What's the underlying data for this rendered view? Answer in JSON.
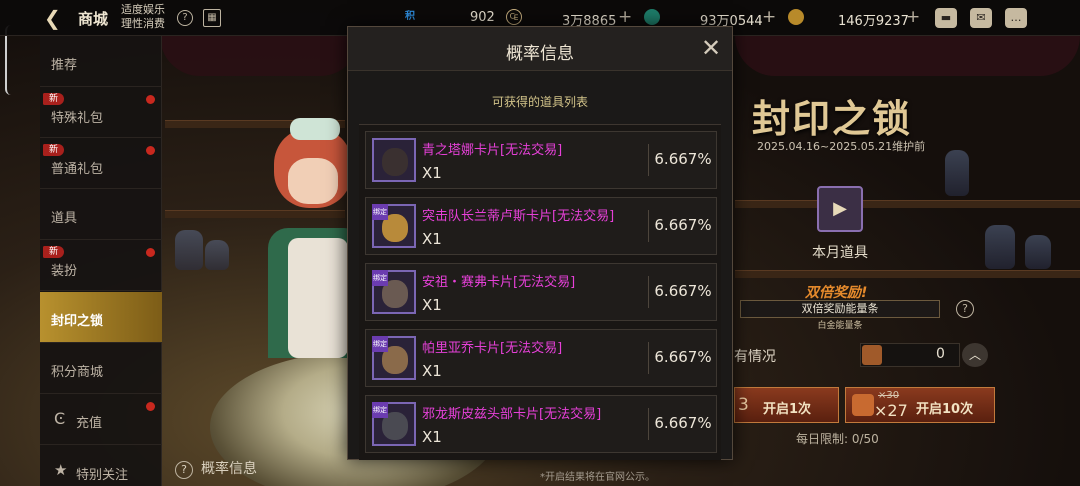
{
  "topbar": {
    "back_icon": "back-arrow-icon",
    "title": "商城",
    "notice_line1": "适度娱乐",
    "notice_line2": "理性消费",
    "help_icon": "question-icon",
    "calendar_icon": "calendar-icon",
    "points_icon_text": "积",
    "points_value": "902",
    "gold_value": "3万8865",
    "gem_value": "93万0544",
    "coin_value": "146万9237",
    "plus": "+",
    "icons": [
      "bag-icon",
      "mail-icon",
      "chat-icon"
    ]
  },
  "sidebar": {
    "items": [
      {
        "label": "推荐",
        "new": "",
        "dot": false
      },
      {
        "label": "特殊礼包",
        "new": "新",
        "dot": true
      },
      {
        "label": "普通礼包",
        "new": "新",
        "dot": true
      },
      {
        "label": "道具",
        "new": "",
        "dot": false
      },
      {
        "label": "装扮",
        "new": "新",
        "dot": true
      },
      {
        "label": "封印之锁",
        "new": "",
        "dot": false,
        "active": true
      },
      {
        "label": "积分商城",
        "new": "",
        "dot": false
      },
      {
        "label": "充值",
        "new": "",
        "dot": true
      },
      {
        "label": "特别关注",
        "new": "",
        "dot": false
      }
    ]
  },
  "event": {
    "title": "封印之锁",
    "dates": "2025.04.16~2025.05.21维护前",
    "month_label": "本月道具",
    "double_title": "双倍奖励!",
    "double_bar": "双倍奖励能量条",
    "double_sub": "白金能量条",
    "status_label": "有情况",
    "status_value": "0",
    "btn1_count": "3",
    "btn1_label": "开启1次",
    "btn10_strike": "×30",
    "btn10_count": "×27",
    "btn10_label": "开启10次",
    "daily_limit": "每日限制: 0/50",
    "footnote": "*开启结果将在官网公示。",
    "prob_link": "概率信息"
  },
  "modal": {
    "title": "概率信息",
    "close_icon": "close-icon",
    "subtitle": "可获得的道具列表",
    "bind_tag": "绑定",
    "items": [
      {
        "name": "青之塔娜卡片[无法交易]",
        "qty": "X1",
        "pct": "6.667%",
        "face": "#3a3030",
        "tag": false
      },
      {
        "name": "突击队长兰蒂卢斯卡片[无法交易]",
        "qty": "X1",
        "pct": "6.667%",
        "face": "#b88a3a",
        "tag": true
      },
      {
        "name": "安祖・赛弗卡片[无法交易]",
        "qty": "X1",
        "pct": "6.667%",
        "face": "#6a5a52",
        "tag": true
      },
      {
        "name": "帕里亚乔卡片[无法交易]",
        "qty": "X1",
        "pct": "6.667%",
        "face": "#8a6a4a",
        "tag": true
      },
      {
        "name": "邪龙斯皮兹头部卡片[无法交易]",
        "qty": "X1",
        "pct": "6.667%",
        "face": "#4a4a52",
        "tag": true
      }
    ]
  }
}
